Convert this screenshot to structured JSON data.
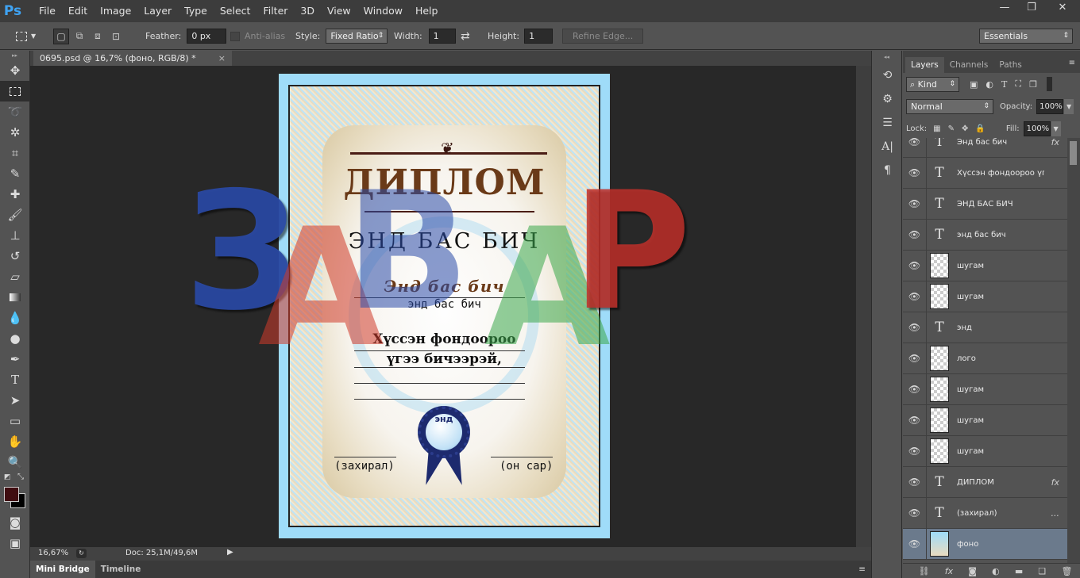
{
  "app": {
    "logo": "Ps"
  },
  "menu": [
    "File",
    "Edit",
    "Image",
    "Layer",
    "Type",
    "Select",
    "Filter",
    "3D",
    "View",
    "Window",
    "Help"
  ],
  "window_controls": {
    "minimize": "—",
    "restore": "❐",
    "close": "✕"
  },
  "options": {
    "feather_label": "Feather:",
    "feather_value": "0 px",
    "antialias_label": "Anti-alias",
    "style_label": "Style:",
    "style_value": "Fixed Ratio",
    "width_label": "Width:",
    "width_value": "1",
    "height_label": "Height:",
    "height_value": "1",
    "refine_label": "Refine Edge...",
    "workspace": "Essentials"
  },
  "document": {
    "tab_title": "0695.psd @ 16,7% (фоно, RGB/8) *",
    "close": "×",
    "zoom": "16,67%",
    "doc_info": "Doc: 25,1M/49,6M"
  },
  "diploma": {
    "title": "ДИПЛОМ",
    "line1": "ЭНД БАС БИЧ",
    "line2": "Энд бас бич",
    "line3": "энд бас бич",
    "line4": "Хүссэн фондоороо",
    "line5": "үгээ бичээрэй,",
    "seal": "энд",
    "left_sign": "(захирал)",
    "right_sign": "(он сар)"
  },
  "watermark": {
    "letters": [
      "З",
      "А",
      "В",
      "А",
      "Р"
    ],
    "colors": [
      "#2a4aa8",
      "#d03a2a",
      "#f3c93a",
      "#2a4aa8",
      "#3aa84a",
      "#c0302a"
    ]
  },
  "bottom_tabs": [
    "Mini Bridge",
    "Timeline"
  ],
  "panel": {
    "tabs": [
      "Layers",
      "Channels",
      "Paths"
    ],
    "kind_label": "Kind",
    "blend_mode": "Normal",
    "opacity_label": "Opacity:",
    "opacity_value": "100%",
    "lock_label": "Lock:",
    "fill_label": "Fill:",
    "fill_value": "100%",
    "layers": [
      {
        "name": "Энд бас бич",
        "kind": "text",
        "fx": "fx"
      },
      {
        "name": "Хүссэн фондоороо үгэ...",
        "kind": "text",
        "fx": ""
      },
      {
        "name": "ЭНД БАС БИЧ",
        "kind": "text",
        "fx": ""
      },
      {
        "name": "энд бас бич",
        "kind": "text",
        "fx": ""
      },
      {
        "name": "шугам",
        "kind": "raster",
        "fx": ""
      },
      {
        "name": "шугам",
        "kind": "raster",
        "fx": ""
      },
      {
        "name": "энд",
        "kind": "text",
        "fx": ""
      },
      {
        "name": "лого",
        "kind": "raster",
        "fx": ""
      },
      {
        "name": "шугам",
        "kind": "raster",
        "fx": ""
      },
      {
        "name": "шугам",
        "kind": "raster",
        "fx": ""
      },
      {
        "name": "шугам",
        "kind": "raster",
        "fx": ""
      },
      {
        "name": "ДИПЛОМ",
        "kind": "text",
        "fx": "fx"
      },
      {
        "name": "(захирал)",
        "kind": "text",
        "fx": "..."
      },
      {
        "name": "фоно",
        "kind": "image",
        "fx": "",
        "selected": true
      }
    ]
  }
}
